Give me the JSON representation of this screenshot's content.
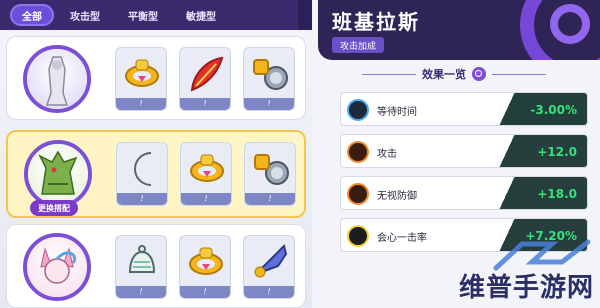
{
  "tabs": [
    {
      "label": "全部",
      "active": true
    },
    {
      "label": "攻击型",
      "active": false
    },
    {
      "label": "平衡型",
      "active": false
    },
    {
      "label": "敏捷型",
      "active": false
    }
  ],
  "builds": [
    {
      "pokemon": "white-armored-pokemon",
      "badge": "",
      "items": [
        {
          "icon": "golden-ring-icon",
          "level": "!"
        },
        {
          "icon": "red-feather-icon",
          "level": "!"
        },
        {
          "icon": "scope-lens-icon",
          "level": "!"
        }
      ]
    },
    {
      "pokemon": "tyranitar",
      "badge": "更换搭配",
      "items": [
        {
          "icon": "silver-crescent-icon",
          "level": "!"
        },
        {
          "icon": "golden-ring-icon",
          "level": "!"
        },
        {
          "icon": "scope-lens-icon",
          "level": "!"
        }
      ]
    },
    {
      "pokemon": "sylveon",
      "badge": "",
      "items": [
        {
          "icon": "bell-icon",
          "level": "!"
        },
        {
          "icon": "golden-ring-icon",
          "level": "!"
        },
        {
          "icon": "horn-icon",
          "level": "!"
        }
      ]
    }
  ],
  "detail": {
    "name": "班基拉斯",
    "role": "攻击加成",
    "section_title": "效果一览",
    "stats": [
      {
        "icon": "clock-icon",
        "label": "等待时间",
        "value": "-3.00%"
      },
      {
        "icon": "attack-fist-icon",
        "label": "攻击",
        "value": "+12.0"
      },
      {
        "icon": "pierce-defense-icon",
        "label": "无视防御",
        "value": "+18.0"
      },
      {
        "icon": "critical-hit-icon",
        "label": "会心一击率",
        "value": "+7.20%"
      }
    ]
  },
  "watermark": "维普手游网",
  "colors": {
    "accent": "#6c4fd8",
    "positive": "#36e07c",
    "header": "#2f2456",
    "selected": "#f1c84c"
  }
}
